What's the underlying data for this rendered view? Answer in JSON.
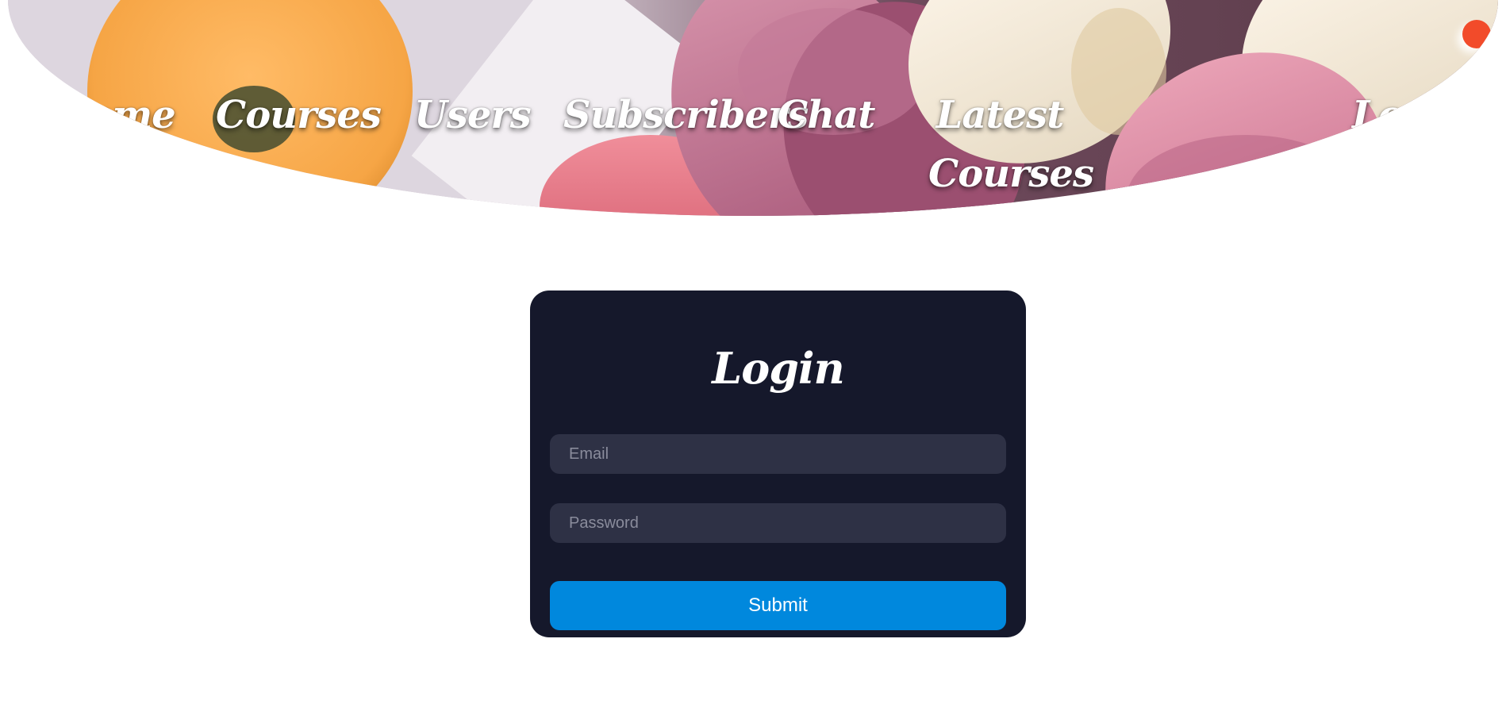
{
  "nav": {
    "home": "Home",
    "courses": "Courses",
    "users": "Users",
    "subscribers": "Subscribers",
    "chat": "Chat",
    "latest_courses": "Latest Courses",
    "login": "Login"
  },
  "login_form": {
    "title": "Login",
    "email_placeholder": "Email",
    "password_placeholder": "Password",
    "submit_label": "Submit"
  },
  "colors": {
    "card_background": "#15182b",
    "input_background": "#2e3145",
    "submit_button": "#0088dd",
    "status_dot": "#f24b2a"
  }
}
